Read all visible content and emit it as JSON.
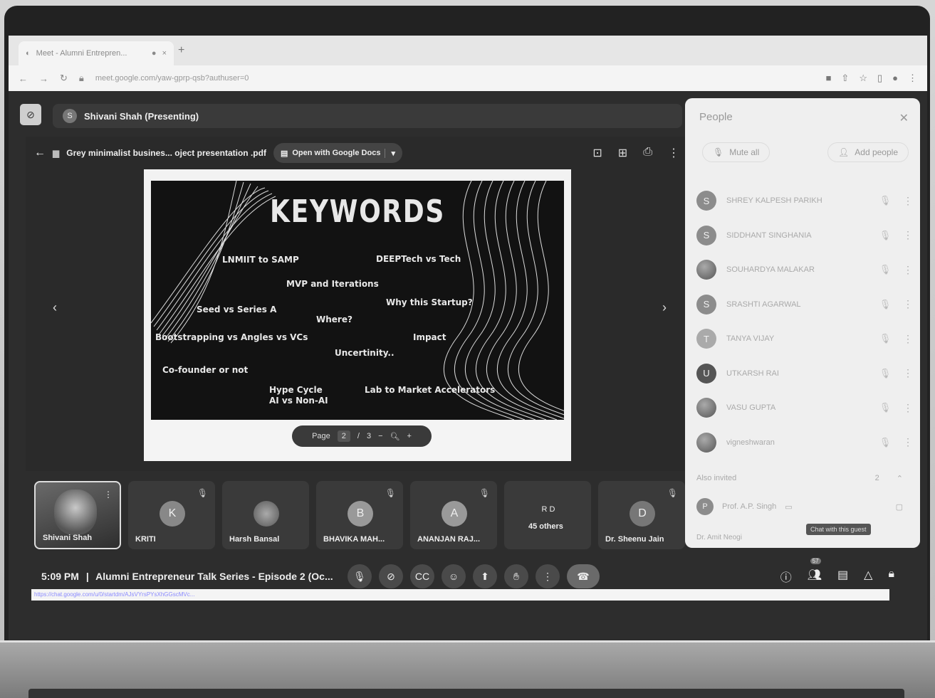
{
  "browser": {
    "tab_title": "Meet - Alumni Entrepren...",
    "url": "meet.google.com/yaw-gprp-qsb?authuser=0",
    "status_url": "https://chat.google.com/u/0/startdm/AJsVYrsPYsXhGGscMVc..."
  },
  "meet": {
    "presenter": "Shivani Shah (Presenting)",
    "presenter_initial": "S",
    "file_name": "Grey minimalist busines... oject presentation .pdf",
    "open_with": "Open with Google Docs",
    "meeting_time": "5:09 PM",
    "meeting_title": "Alumni Entrepreneur Talk Series - Episode 2 (Oc...",
    "separator": "|"
  },
  "slide": {
    "title": "KEYWORDS",
    "keywords": [
      "LNMIIT to SAMP",
      "DEEPTech vs Tech",
      "MVP and Iterations",
      "Why this Startup?",
      "Seed vs Series A",
      "Where?",
      "Bootstrapping vs Angles vs VCs",
      "Impact",
      "Uncertinity..",
      "Co-founder or not",
      "Hype Cycle",
      "AI vs Non-AI",
      "Lab to Market Accelerators"
    ]
  },
  "pager": {
    "label": "Page",
    "current": "2",
    "sep": "/",
    "total": "3"
  },
  "people": {
    "title": "People",
    "mute_all": "Mute all",
    "add_people": "Add people",
    "participants": [
      {
        "initial": "S",
        "name": "SHREY KALPESH PARIKH"
      },
      {
        "initial": "S",
        "name": "SIDDHANT SINGHANIA"
      },
      {
        "initial": "",
        "name": "SOUHARDYA MALAKAR"
      },
      {
        "initial": "S",
        "name": "SRASHTI AGARWAL"
      },
      {
        "initial": "T",
        "name": "TANYA VIJAY"
      },
      {
        "initial": "U",
        "name": "UTKARSH RAI"
      },
      {
        "initial": "",
        "name": "VASU GUPTA"
      },
      {
        "initial": "",
        "name": "vigneshwaran"
      }
    ],
    "also_invited": "Also invited",
    "also_invited_count": "2",
    "invited_1": "Prof. A.P. Singh",
    "invited_2": "Dr. Amit Neogi",
    "chat_tooltip": "Chat with this guest",
    "people_badge": "57"
  },
  "tiles": [
    {
      "initial": "",
      "name": "Shivani Shah"
    },
    {
      "initial": "K",
      "name": "KRITI"
    },
    {
      "initial": "",
      "name": "Harsh Bansal"
    },
    {
      "initial": "B",
      "name": "BHAVIKA MAH..."
    },
    {
      "initial": "A",
      "name": "ANANJAN RAJ..."
    },
    {
      "initial": "R D",
      "name": "45 others"
    },
    {
      "initial": "D",
      "name": "Dr. Sheenu Jain"
    }
  ]
}
